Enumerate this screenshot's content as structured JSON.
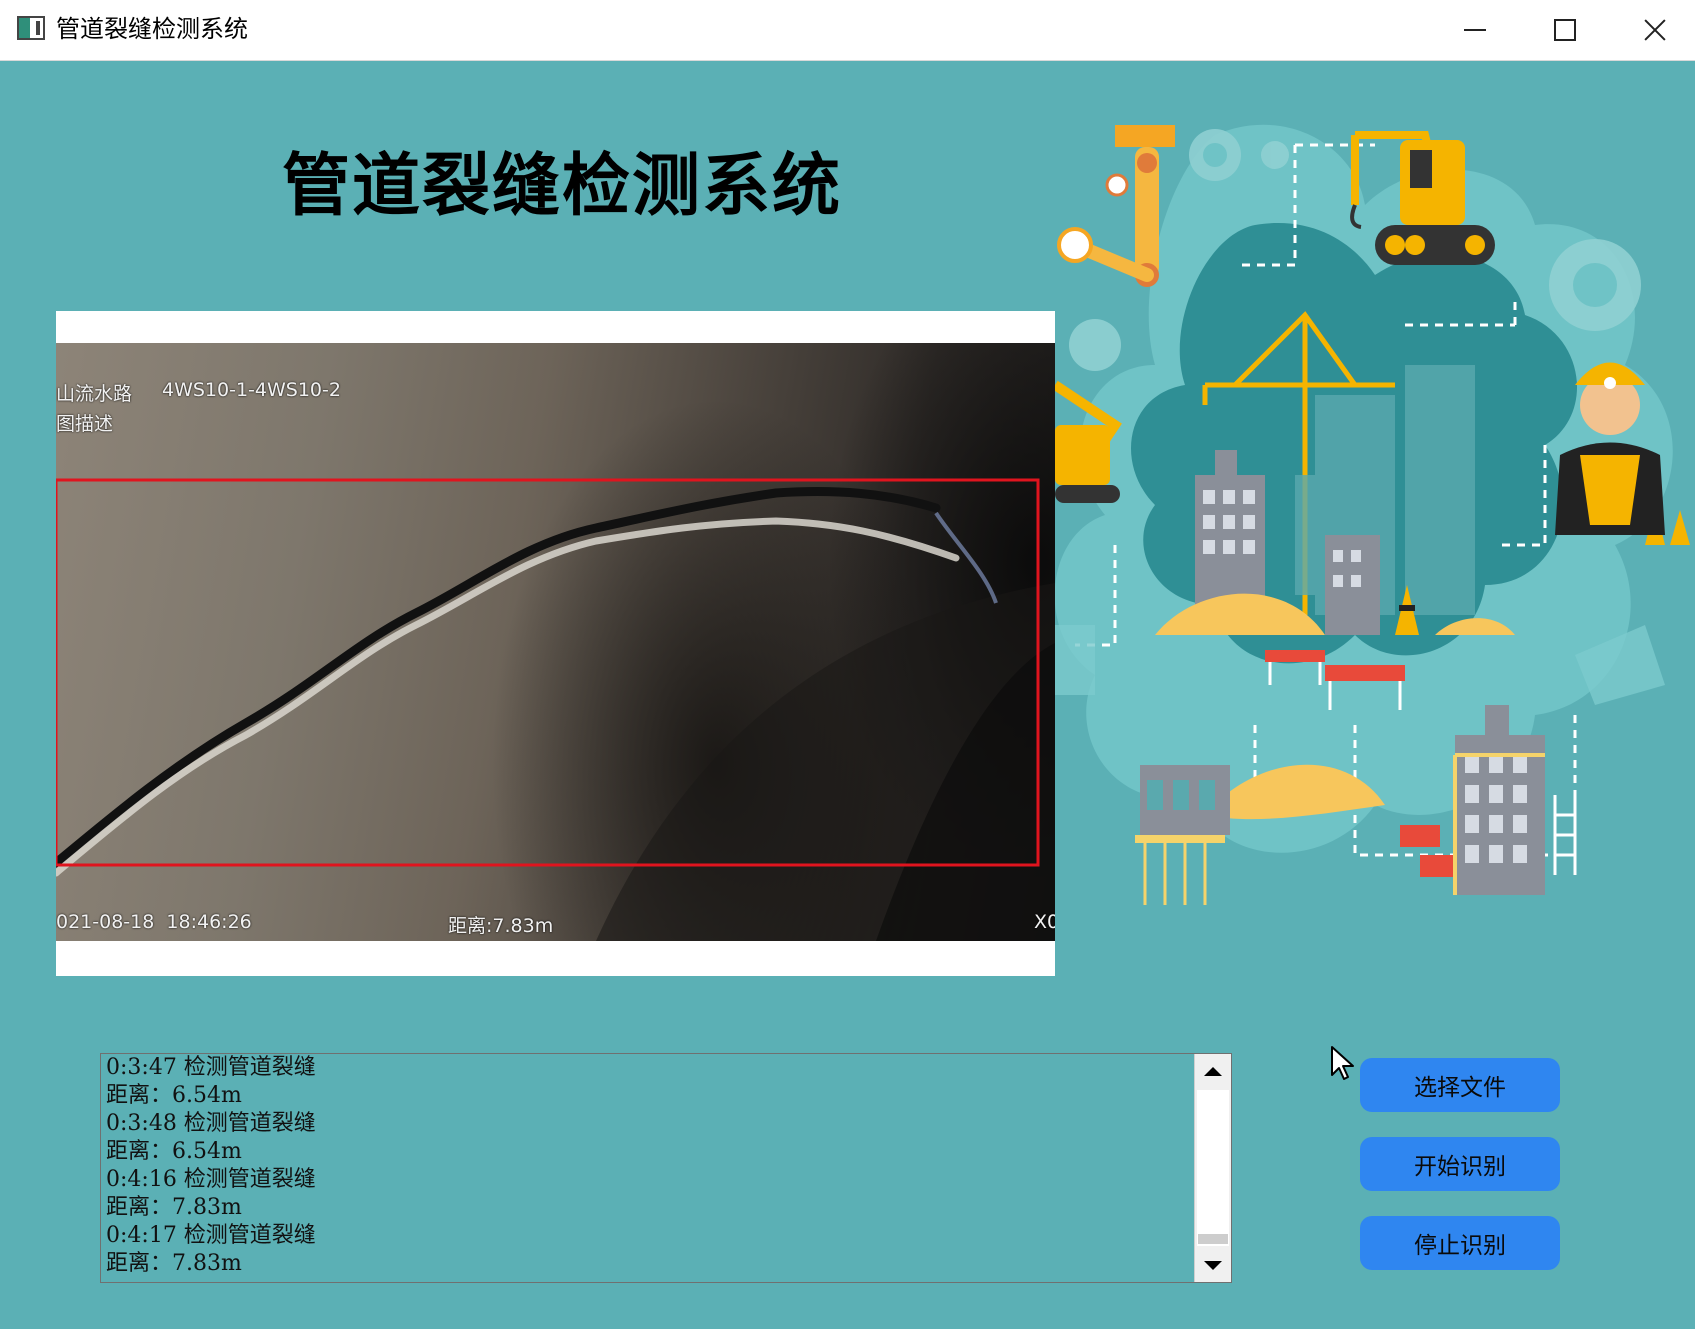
{
  "window": {
    "title": "管道裂缝检测系统",
    "controls": {
      "minimize": "minimize-icon",
      "maximize": "maximize-icon",
      "close": "close-icon"
    }
  },
  "main": {
    "heading": "管道裂缝检测系统"
  },
  "video": {
    "overlay_location": "山流水路",
    "overlay_code": "4WS10-1-4WS10-2",
    "overlay_desc": "图描述",
    "overlay_time": "021-08-18  18:46:26",
    "overlay_distance": "距离:7.83m",
    "overlay_x": "X0",
    "detection_box_color": "#e0141e"
  },
  "log": {
    "lines": [
      "0:3:47 检测管道裂缝",
      "距离：6.54m",
      "0:3:48 检测管道裂缝",
      "距离：6.54m",
      "0:4:16 检测管道裂缝",
      "距离：7.83m",
      "0:4:17 检测管道裂缝",
      "距离：7.83m"
    ]
  },
  "buttons": {
    "select_file": "选择文件",
    "start_recognition": "开始识别",
    "stop_recognition": "停止识别"
  },
  "colors": {
    "background": "#5bb0b5",
    "button": "#2f86f0"
  }
}
